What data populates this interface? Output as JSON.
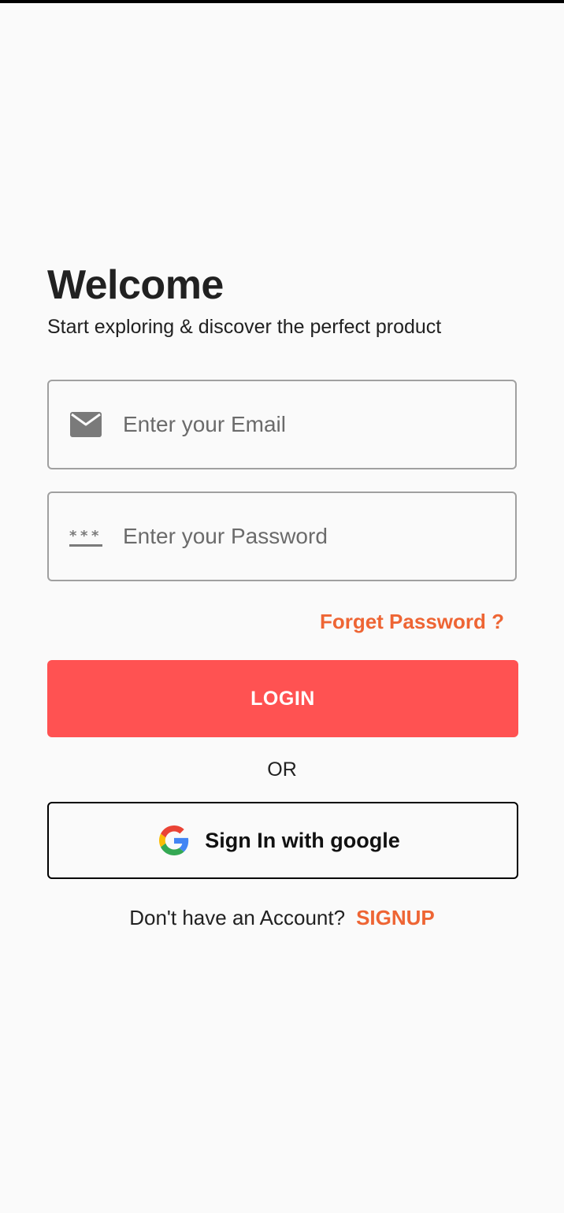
{
  "header": {
    "title": "Welcome",
    "subtitle": "Start exploring & discover the perfect product"
  },
  "form": {
    "email": {
      "placeholder": "Enter your Email",
      "value": "",
      "icon": "mail-icon"
    },
    "password": {
      "placeholder": "Enter your Password",
      "value": "",
      "icon": "password-dots-icon"
    },
    "forgot_label": "Forget Password ?",
    "login_label": "LOGIN",
    "or_label": "OR",
    "google_label": "Sign In with google",
    "google_icon": "google-logo-icon"
  },
  "footer": {
    "prompt": "Don't have an Account?",
    "signup_label": "SIGNUP"
  },
  "colors": {
    "accent": "#ff5252",
    "link": "#ee6534",
    "background": "#fafafa",
    "border": "#a0a0a0"
  }
}
